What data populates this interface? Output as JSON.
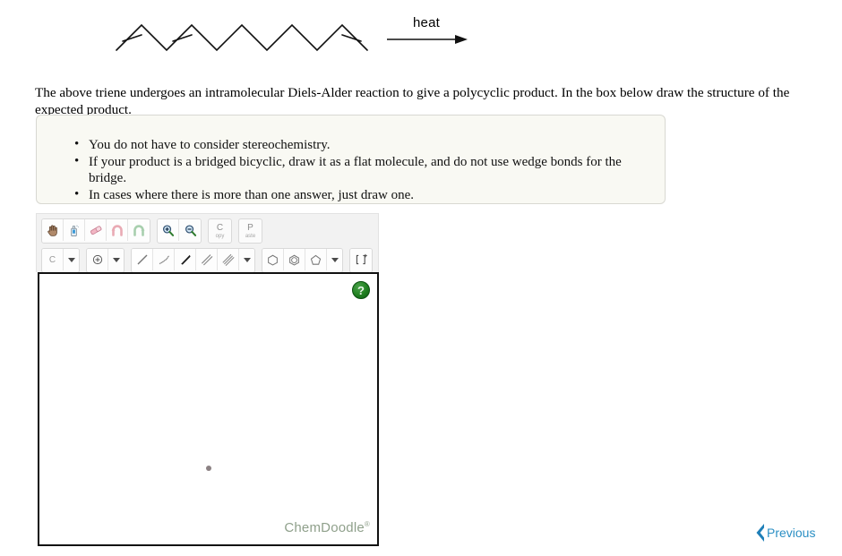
{
  "reaction": {
    "reactant_name": "deca-1,3,9-triene skeletal structure",
    "reagent_label": "heat",
    "arrow": "forward-reaction-arrow"
  },
  "prompt": {
    "text": "The above triene undergoes an intramolecular Diels-Alder reaction to give a polycyclic product. In the box below draw the structure of the expected product."
  },
  "notes": {
    "items": [
      "You do not have to consider stereochemistry.",
      "If your product is a bridged bicyclic, draw it as a flat molecule, and do not use wedge bonds for the bridge.",
      "In cases where there is more than one answer, just draw one."
    ]
  },
  "sketcher": {
    "toolbar_row1": [
      {
        "name": "pan-hand-tool",
        "icon": "hand-icon"
      },
      {
        "name": "erase-all-tool",
        "icon": "spray-can-icon"
      },
      {
        "name": "eraser-tool",
        "icon": "eraser-icon"
      },
      {
        "name": "undo-tool",
        "icon": "undo-arrow-icon"
      },
      {
        "name": "redo-tool",
        "icon": "redo-arrow-icon"
      },
      {
        "name": "zoom-in-tool",
        "icon": "magnifier-plus-icon"
      },
      {
        "name": "zoom-out-tool",
        "icon": "magnifier-minus-icon"
      }
    ],
    "copy_button": {
      "big": "C",
      "small": "opy"
    },
    "paste_button": {
      "big": "P",
      "small": "aste"
    },
    "element_button_label": "C",
    "toolbar_row2": [
      {
        "name": "element-label-tool",
        "icon": "element-letter-icon"
      },
      {
        "name": "element-dropdown",
        "icon": "chevron-down-icon"
      },
      {
        "name": "charge-tool",
        "icon": "plus-circle-icon"
      },
      {
        "name": "charge-dropdown",
        "icon": "chevron-down-icon"
      },
      {
        "name": "single-bond-tool",
        "icon": "single-bond-icon"
      },
      {
        "name": "hash-bond-tool",
        "icon": "hashed-wedge-bond-icon"
      },
      {
        "name": "wedge-bond-tool",
        "icon": "solid-wedge-bond-icon"
      },
      {
        "name": "double-bond-tool",
        "icon": "double-bond-icon"
      },
      {
        "name": "triple-bond-tool",
        "icon": "triple-bond-icon"
      },
      {
        "name": "bond-dropdown",
        "icon": "chevron-down-icon"
      },
      {
        "name": "cyclohexane-ring-tool",
        "icon": "hexagon-icon"
      },
      {
        "name": "benzene-ring-tool",
        "icon": "benzene-ring-icon"
      },
      {
        "name": "cyclopentane-ring-tool",
        "icon": "pentagon-icon"
      },
      {
        "name": "ring-dropdown",
        "icon": "chevron-down-icon"
      },
      {
        "name": "bracket-charge-tool",
        "icon": "bracket-charge-icon"
      }
    ],
    "help_label": "?",
    "watermark": "ChemDoodle",
    "watermark_mark": "®"
  },
  "navigation": {
    "previous_label": "Previous"
  },
  "colors": {
    "link_blue": "#2b8fc4",
    "watermark_green": "#8fa08b",
    "notes_bg": "#f9f9f3",
    "notes_border": "#d8d8d2",
    "toolbar_bg": "#f2f2f2",
    "canvas_border": "#111111",
    "help_green": "#218021"
  }
}
